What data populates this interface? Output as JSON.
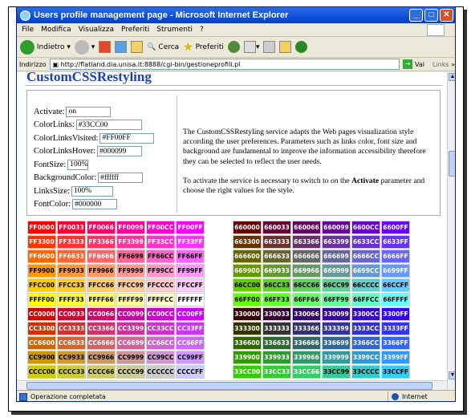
{
  "window": {
    "title": "Users profile management page - Microsoft Internet Explorer"
  },
  "menu": [
    "File",
    "Modifica",
    "Visualizza",
    "Preferiti",
    "Strumenti",
    "?"
  ],
  "toolbar": {
    "back": "Indietro",
    "search": "Cerca",
    "favorites": "Preferiti"
  },
  "addressbar": {
    "label": "Indirizzo",
    "url": "http://flatland.dia.unisa.it:8888/cgi-bin/gestioneprofili.pl",
    "go": "Vai",
    "links": "Links"
  },
  "page": {
    "heading": "CustomCSSRestyling"
  },
  "form": {
    "fields": [
      {
        "label": "Activate:",
        "value": "on",
        "w": 56
      },
      {
        "label": "ColorLinks:",
        "value": "#33CC00",
        "w": 82
      },
      {
        "label": "ColorLinksVisited:",
        "value": "#FF00FF",
        "w": 68
      },
      {
        "label": "ColorLinksHover:",
        "value": "#000099",
        "w": 56
      },
      {
        "label": "FontSize:",
        "value": "100%",
        "w": 26
      },
      {
        "label": "BackgroundColor:",
        "value": "#ffffff",
        "w": 56
      },
      {
        "label": "LinksSize:",
        "value": "100%",
        "w": 52
      },
      {
        "label": "FontColor:",
        "value": "#000000",
        "w": 56
      }
    ]
  },
  "description": {
    "p1": "The CustomCSSRestyling service adapts the Web pages visualization style according the user preferences. Parameters such as links color, font size and background are fundamental to improve the information accessibility therefore they can be selected to reflect the user needs.",
    "p2_a": "To activate the service is necessary to switch to ",
    "p2_on": "on",
    "p2_b": " the ",
    "p2_bold": "Activate",
    "p2_c": " parameter and choose the right values for the style."
  },
  "palette": {
    "left": [
      [
        "FF0000",
        "FF0033",
        "FF0066",
        "FF0099",
        "FF00CC",
        "FF00FF"
      ],
      [
        "FF3300",
        "FF3333",
        "FF3366",
        "FF3399",
        "FF33CC",
        "FF33FF"
      ],
      [
        "FF6600",
        "FF6633",
        "FF6666",
        "FF6699",
        "FF66CC",
        "FF66FF"
      ],
      [
        "FF9900",
        "FF9933",
        "FF9966",
        "FF9999",
        "FF99CC",
        "FF99FF"
      ],
      [
        "FFCC00",
        "FFCC33",
        "FFCC66",
        "FFCC99",
        "FFCCCC",
        "FFCCFF"
      ],
      [
        "FFFF00",
        "FFFF33",
        "FFFF66",
        "FFFF99",
        "FFFFCC",
        "FFFFFF"
      ],
      [
        "CC0000",
        "CC0033",
        "CC0066",
        "CC0099",
        "CC00CC",
        "CC00FF"
      ],
      [
        "CC3300",
        "CC3333",
        "CC3366",
        "CC3399",
        "CC33CC",
        "CC33FF"
      ],
      [
        "CC6600",
        "CC6633",
        "CC6666",
        "CC6699",
        "CC66CC",
        "CC66FF"
      ],
      [
        "CC9900",
        "CC9933",
        "CC9966",
        "CC9999",
        "CC99CC",
        "CC99FF"
      ],
      [
        "CCCC00",
        "CCCC33",
        "CCCC66",
        "CCCC99",
        "CCCCCC",
        "CCCCFF"
      ]
    ],
    "right": [
      [
        "660000",
        "660033",
        "660066",
        "660099",
        "6600CC",
        "6600FF"
      ],
      [
        "663300",
        "663333",
        "663366",
        "663399",
        "6633CC",
        "6633FF"
      ],
      [
        "666600",
        "666633",
        "666666",
        "666699",
        "6666CC",
        "6666FF"
      ],
      [
        "669900",
        "669933",
        "669966",
        "669999",
        "6699CC",
        "6699FF"
      ],
      [
        "66CC00",
        "66CC33",
        "66CC66",
        "66CC99",
        "66CCCC",
        "66CCFF"
      ],
      [
        "66FF00",
        "66FF33",
        "66FF66",
        "66FF99",
        "66FFCC",
        "66FFFF"
      ],
      [
        "330000",
        "330033",
        "330066",
        "330099",
        "3300CC",
        "3300FF"
      ],
      [
        "333300",
        "333333",
        "333366",
        "333399",
        "3333CC",
        "3333FF"
      ],
      [
        "336600",
        "336633",
        "336666",
        "336699",
        "3366CC",
        "3366FF"
      ],
      [
        "339900",
        "339933",
        "339966",
        "339999",
        "3399CC",
        "3399FF"
      ],
      [
        "33CC00",
        "33CC33",
        "33CC66",
        "33CC99",
        "33CCCC",
        "33CCFF"
      ]
    ]
  },
  "status": {
    "text": "Operazione completata",
    "zone": "Internet"
  }
}
